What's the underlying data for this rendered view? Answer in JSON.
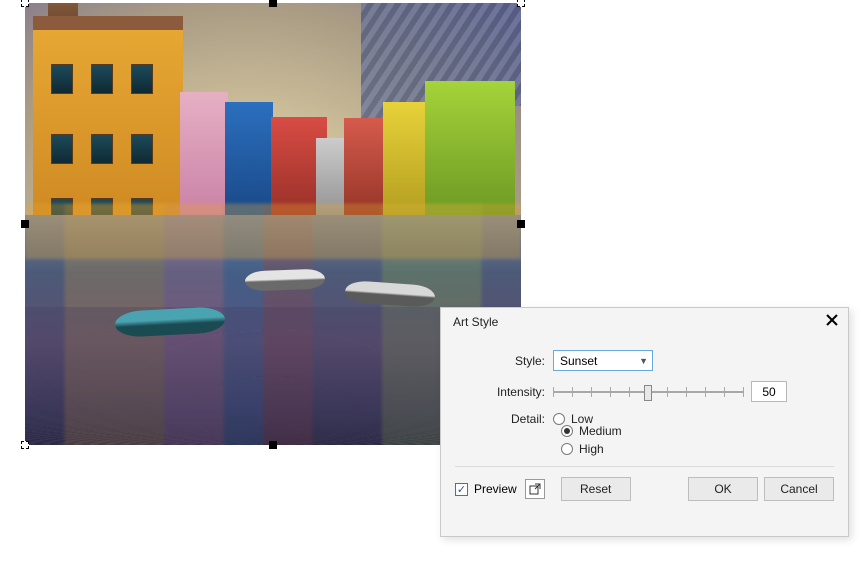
{
  "dialog": {
    "title": "Art Style",
    "style_label": "Style:",
    "style_value": "Sunset",
    "intensity_label": "Intensity:",
    "intensity_value": "50",
    "intensity_slider_pct": 50,
    "detail_label": "Detail:",
    "detail_options": {
      "low": "Low",
      "medium": "Medium",
      "high": "High"
    },
    "detail_selected": "Medium",
    "preview_label": "Preview",
    "preview_checked": true,
    "buttons": {
      "reset": "Reset",
      "ok": "OK",
      "cancel": "Cancel"
    }
  }
}
